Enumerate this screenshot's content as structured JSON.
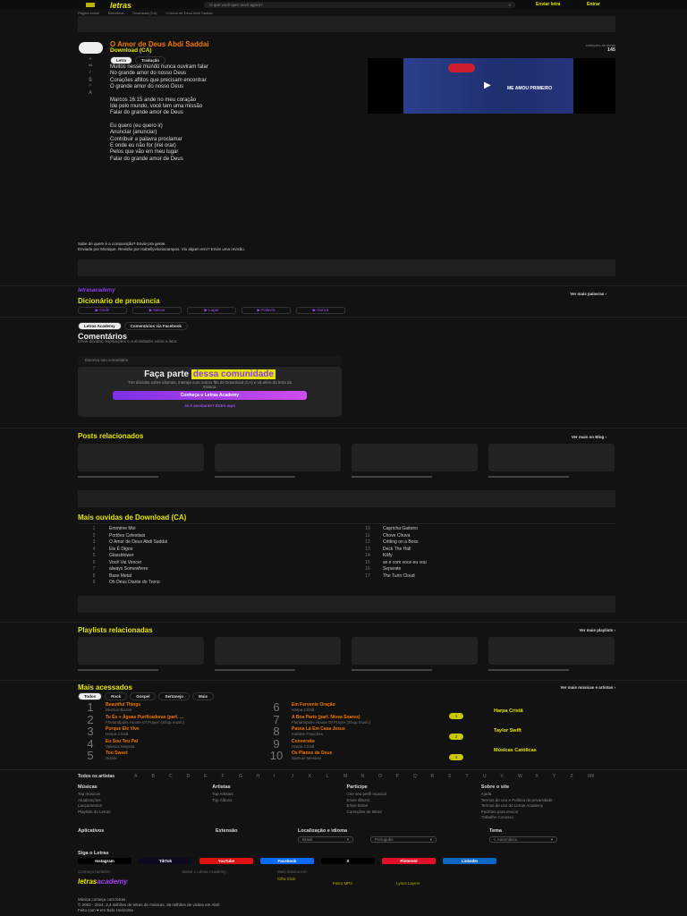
{
  "header": {
    "search_placeholder": "O que você quer ouvir agora?",
    "send_lyrics": "Enviar letra",
    "login": "Entrar",
    "logo": "letras"
  },
  "breadcrumb": [
    "Página inicial",
    "Eletrônica",
    "Download (CA)",
    "O Amor de Deus Abdi Saddai"
  ],
  "song": {
    "title": "O Amor de Deus Abdi Saddai",
    "artist": "Download (CA)",
    "tab_lyrics": "Letra",
    "tab_translation": "Tradução",
    "views_label": "exibições de letras",
    "views": "145",
    "stanzas": [
      [
        "Muitos nesse mundo nunca ouviram falar",
        "No grande amor do nosso Deus",
        "Corações aflitos que precisam encontrar",
        "O grande amor do nosso Deus"
      ],
      [
        "Marcos 16:15 ande no meu coração",
        "Ide pelo mundo, você tem uma missão",
        "Falar do grande amor de Deus"
      ],
      [
        "Eu quero (eu quero ir)",
        "Anunciar (anunciar)",
        "Contribuir a palavra proclamar",
        "E onde eu não for (irei orar)",
        "Pelos que vão em meu lugar",
        "Falar do grande amor de Deus"
      ]
    ],
    "video_caption": "ME AMOU PRIMEIRO",
    "composer": "Sabe de quem é a composição? Envie pra gente.",
    "credits": "Enviada por Monique. Revisão por Isabellyvitoriacampos. Viu algum erro? Envie uma revisão."
  },
  "dictionary": {
    "brand": "letrasacademy",
    "title": "Dicionário de pronúncia",
    "more": "Ver mais palavras",
    "words": [
      "Onde",
      "Nesse",
      "Lugar",
      "Palavra",
      "Nunca"
    ]
  },
  "comments": {
    "tab1": "Letras Academy",
    "tab2": "Comentários via Facebook",
    "title": "Comentários",
    "subtitle": "Envie dúvidas, explicações e curiosidades sobre a letra",
    "placeholder": "Escreva seu comentário",
    "join": "Faça parte",
    "join_hl": "dessa comunidade",
    "join_text": "Tire dúvidas sobre idiomas, interaja com outros fãs de Download (CA) e vá além da letra da música.",
    "cta": "Conheça o Letras Academy",
    "login": "Já é assinante? Entre aqui"
  },
  "posts": {
    "title": "Posts relacionados",
    "more": "Ver mais no Blog"
  },
  "top_artist": {
    "title": "Mais ouvidas de Download (CA)",
    "songs": [
      "Emmène Moi",
      "Portões Celestiais",
      "O Amor de Deus Abdi Saddai",
      "Ele É Digno",
      "Glassblower",
      "Você Vai Vencer",
      "always Somewhere",
      "Base Metal",
      "Oh Deus Diante do Trono",
      "Capricha Gaiteiro",
      "Chove Chuva",
      "Critting on a Boss",
      "Deck The Hall",
      "Kilify",
      "se é com voce eu vou",
      "Separate",
      "The Turin Cloud"
    ]
  },
  "playlists": {
    "title": "Playlists relacionadas",
    "more": "Ver mais playlists"
  },
  "most": {
    "title": "Mais acessados",
    "more": "Ver mais músicas e artistas",
    "filters": [
      "Todos",
      "Rock",
      "Gospel",
      "Sertanejo",
      "Mais"
    ],
    "songs": [
      [
        "Beautiful Things",
        "Benson Boone"
      ],
      [
        "Tu És + Águas Purificadoras (part. ...",
        "Fhelandpolis House Of Prayer (Shop music)"
      ],
      [
        "Porque Ele Vive",
        "Harpa Cristã"
      ],
      [
        "Eu Sou Teu Pai",
        "Valesca Mayssa"
      ],
      [
        "Too Sweet",
        "Hozier"
      ],
      [
        "Em Fervente Oração",
        "Harpa Cristã"
      ],
      [
        "A Boa Parte (part. Nívea Soares)",
        "Florianópolis House Of Prayer (Shop music)"
      ],
      [
        "Passa Lá Em Casa Jesus",
        "Kailane Frauches"
      ],
      [
        "Conversão",
        "Harpa Cristã"
      ],
      [
        "Os Planos de Deus",
        "Samuel Messias"
      ]
    ],
    "artists": [
      "Harpa Cristã",
      "Taylor Swift",
      "Músicas Católicas"
    ]
  },
  "footer": {
    "all_artists": "Todos os artistas",
    "letters": [
      "A",
      "B",
      "C",
      "D",
      "E",
      "F",
      "G",
      "H",
      "I",
      "J",
      "K",
      "L",
      "M",
      "N",
      "O",
      "P",
      "Q",
      "R",
      "S",
      "T",
      "U",
      "V",
      "W",
      "X",
      "Y",
      "Z",
      "0/9"
    ],
    "cols": [
      {
        "h": "Músicas",
        "items": [
          "Top músicas",
          "Atualizações",
          "Lançamentos",
          "Playlists do Letras"
        ]
      },
      {
        "h": "Artistas",
        "items": [
          "Top Artistas",
          "Top Álbuns"
        ]
      },
      {
        "h": "Participe",
        "items": [
          "Crie seu perfil musical",
          "Envie álbuns",
          "Envie letras",
          "Correções de letras"
        ]
      },
      {
        "h": "Sobre o site",
        "items": [
          "Ajuda",
          "Termos de uso e Política de privacidade",
          "Termos de uso do Letras Academy",
          "Padrões para envios",
          "Trabalhe Conosco"
        ]
      }
    ],
    "apps": "Aplicativos",
    "extension": "Extensão",
    "locale": "Localização e idioma",
    "country": "Brasil",
    "language": "Português",
    "theme": "Tema",
    "theme_value": "Automático",
    "follow": "Siga o Letras",
    "social": [
      "Instagram",
      "TikTok",
      "YouTube",
      "Facebook",
      "X",
      "Pinterest",
      "LinkedIn"
    ],
    "see_also": "Conheça também:",
    "download_app": "Baixe o Letras Academy:",
    "more_music": "Mais música em:",
    "sites": [
      "Cifra Club",
      "Palco MP3",
      "Lyrics Layers"
    ],
    "tagline": "Música começa com letras",
    "copyright": "© 2003 - 2024, 3,4 milhões de letras de músicas, 36 milhões de visitas em Abril",
    "made": "Feito com ♥ em Belo Horizonte"
  },
  "colors": {
    "accent": "#e6e600",
    "orange": "#f07800",
    "purple": "#8b3cf0",
    "bg": "#121212"
  }
}
